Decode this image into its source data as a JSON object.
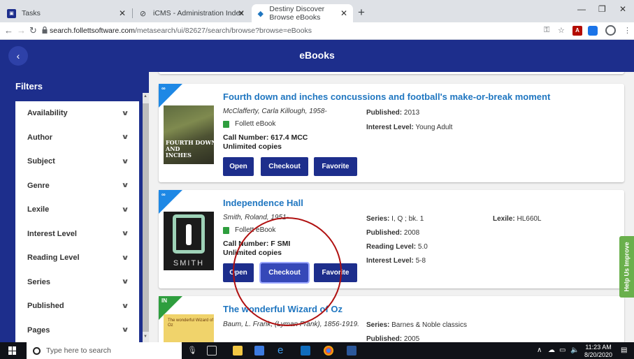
{
  "browser": {
    "tabs": [
      {
        "title": "Tasks",
        "active": false
      },
      {
        "title": "iCMS - Administration Index",
        "active": false
      },
      {
        "title": "Destiny Discover Browse eBooks",
        "active": true
      }
    ],
    "new_tab": "+",
    "url_host": "search.follettsoftware.com",
    "url_path": "/metasearch/ui/82627/search/browse?browse=eBooks",
    "pdf_ext": "A"
  },
  "header": {
    "title": "eBooks",
    "back": "‹"
  },
  "sidebar": {
    "title": "Filters",
    "items": [
      "Availability",
      "Author",
      "Subject",
      "Genre",
      "Lexile",
      "Interest Level",
      "Reading Level",
      "Series",
      "Published",
      "Pages"
    ]
  },
  "books": [
    {
      "badge": "∞",
      "title": "Fourth down and inches concussions and football's make-or-break moment",
      "author": "McClafferty, Carla Killough, 1958-",
      "format": "Follett eBook",
      "call_number": "Call Number: 617.4 MCC",
      "copies": "Unlimited copies",
      "cover_text": "FOURTH DOWN\nAND\nINCHES",
      "published_label": "Published:",
      "published": "2013",
      "interest_label": "Interest Level:",
      "interest": "Young Adult"
    },
    {
      "badge": "∞",
      "title": "Independence Hall",
      "author": "Smith, Roland, 1951-",
      "format": "Follett eBook",
      "call_number": "Call Number: F SMI",
      "copies": "Unlimited copies",
      "cover_text": "SMITH",
      "series_label": "Series:",
      "series": "I, Q ; bk. 1",
      "lexile_label": "Lexile:",
      "lexile": "HL660L",
      "published_label": "Published:",
      "published": "2008",
      "reading_label": "Reading Level:",
      "reading": "5.0",
      "interest_label": "Interest Level:",
      "interest": "5-8"
    },
    {
      "badge": "IN",
      "title": "The wonderful Wizard of Oz",
      "author": "Baum, L. Frank, (Lyman Frank), 1856-1919.",
      "series_label": "Series:",
      "series": "Barnes & Noble classics",
      "published_label": "Published:",
      "published": "2005"
    }
  ],
  "buttons": {
    "open": "Open",
    "checkout": "Checkout",
    "favorite": "Favorite"
  },
  "help_tab": "Help Us Improve",
  "taskbar": {
    "search_placeholder": "Type here to search",
    "time": "11:23 AM",
    "date": "8/20/2020"
  },
  "colors": {
    "brand_navy": "#1d2e8c",
    "link_blue": "#1f76c0",
    "badge_blue": "#1e88e5",
    "badge_green": "#2e9e3e",
    "help_green": "#6ab04c",
    "annotation_red": "#b01010"
  }
}
